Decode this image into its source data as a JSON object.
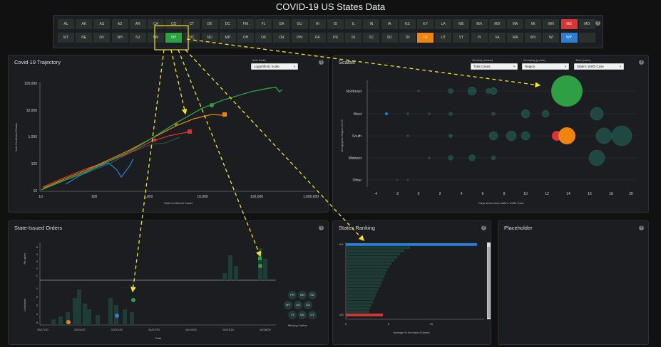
{
  "app_title": "COVID-19 US States Data",
  "states_row1": [
    "AL",
    "AK",
    "AS",
    "AZ",
    "AR",
    "CA",
    "CO",
    "CT",
    "DE",
    "DC",
    "FM",
    "FL",
    "GA",
    "GU",
    "HI",
    "ID",
    "IL",
    "IN",
    "IA",
    "KS",
    "KY",
    "LA",
    "ME",
    "MH",
    "MD",
    "MA",
    "MI",
    "MN",
    "MS",
    "MO"
  ],
  "states_row2": [
    "MT",
    "NE",
    "NV",
    "NH",
    "NJ",
    "NM",
    "NY",
    "NC",
    "ND",
    "MP",
    "OH",
    "OK",
    "OR",
    "PW",
    "PA",
    "PR",
    "RI",
    "SC",
    "SD",
    "TN",
    "TX",
    "UT",
    "VT",
    "VI",
    "VA",
    "WA",
    "WV",
    "WI",
    "WY",
    ""
  ],
  "selected_states": {
    "NY": "#2ea043",
    "TX": "#f0840f",
    "MS": "#d93535",
    "WY": "#2a7fd4"
  },
  "colors": {
    "accent_yellow": "#f5e51b",
    "green": "#2ea043",
    "orange": "#f0840f",
    "red": "#d93535",
    "blue": "#2a7fd4",
    "bubble": "#1f4d45"
  },
  "trajectory": {
    "title": "Covid-19 Trajectory",
    "axis_scale_label": "Axis Scale",
    "axis_scale_value": "Logarithmic Scale",
    "ylabel": "New Confirmed Cases",
    "xlabel": "Total Confirmed Cases",
    "yticks": [
      "100,000",
      "10,000",
      "1,000",
      "100",
      "10"
    ],
    "xticks": [
      "10",
      "100",
      "1,000",
      "10,000",
      "100,000",
      "1,000,000"
    ]
  },
  "scatter": {
    "title": "Scatter",
    "severity_label": "Severity (radius)",
    "severity_value": "Total Cases",
    "grouping_label": "Grouping (y-axis)",
    "grouping_value": "Region",
    "time_label": "Time (color)",
    "time_value": "State's 100th Case",
    "ylabel": "Geographic Region of US",
    "xlabel": "Days since each state's 100th Case",
    "regions": [
      "Northeast",
      "West",
      "South",
      "Midwest",
      "Other"
    ],
    "xticks": [
      "-4",
      "-2",
      "0",
      "2",
      "4",
      "6",
      "8",
      "10",
      "12",
      "14",
      "16",
      "18",
      "20"
    ]
  },
  "orders": {
    "title": "State-Issued Orders",
    "ylabel_top": "Re-open",
    "ylabel_bottom": "Lockdown",
    "xlabel": "Date",
    "yticks_top": [
      "5",
      "4",
      "3",
      "2",
      "1"
    ],
    "yticks_bottom": [
      "1",
      "2",
      "3",
      "4",
      "5"
    ],
    "xticks": [
      "03/17/20",
      "03/24/20",
      "03/31/20",
      "04/07/20",
      "04/14/20",
      "04/21/20",
      "04/28/20"
    ],
    "missing_orders_label": "Missing Orders",
    "missing_orders": [
      "PR",
      "ND",
      "SD",
      "WY",
      "AS",
      "GU",
      "VI",
      "NE",
      "UT"
    ]
  },
  "ranking": {
    "title": "States Ranking",
    "xlabel": "Average % Increase (Cases)",
    "xticks": [
      "0",
      "5",
      "10"
    ],
    "rows": [
      "WY",
      "",
      "",
      "",
      "",
      "",
      "",
      "",
      "",
      "",
      "",
      "",
      "",
      "",
      "",
      "",
      "",
      "",
      "",
      "",
      "",
      "",
      "MS",
      ""
    ]
  },
  "placeholder": {
    "title": "Placeholder"
  }
}
